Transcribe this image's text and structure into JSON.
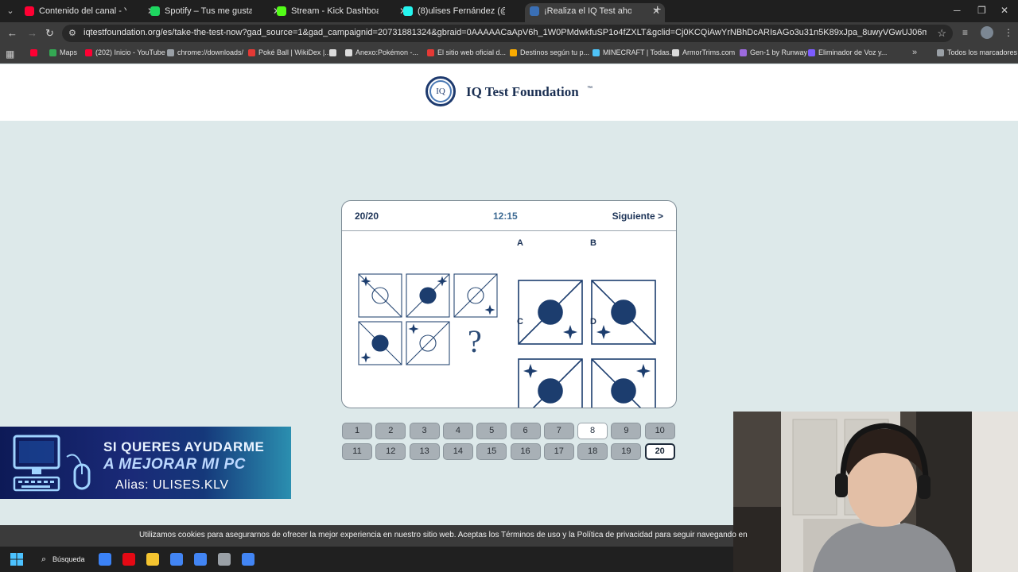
{
  "browser": {
    "tabs": [
      {
        "title": "Contenido del canal - YouTube",
        "color": "#ff0033",
        "active": false
      },
      {
        "title": "Spotify – Tus me gusta",
        "color": "#1ed760",
        "active": false
      },
      {
        "title": "Stream - Kick Dashboard",
        "color": "#53fc18",
        "active": false
      },
      {
        "title": "(8)ulises Fernández (@ulises.klv",
        "color": "#25f4ee",
        "active": false
      },
      {
        "title": "¡Realiza el IQ Test ahora!",
        "color": "#3a6fb5",
        "active": true
      }
    ],
    "tab_favicon_text": [
      "▶",
      "●",
      "K",
      "♪",
      "IQ"
    ],
    "url": "iqtestfoundation.org/es/take-the-test-now?gad_source=1&gad_campaignid=20731881324&gbraid=0AAAAACaApV6h_1W0PMdwkfuSP1o4fZXLT&gclid=Cj0KCQiAwYrNBhDcARIsAGo3u31n5K89xJpa_8uwyVGwUJ06mC_rGWIgqpREziPtqEFW03QtEx9KeY8aG-...",
    "bookmarks": [
      {
        "label": "",
        "color": "#ff0033"
      },
      {
        "label": "Maps",
        "color": "#34a853"
      },
      {
        "label": "(202) Inicio - YouTube",
        "color": "#ff0033"
      },
      {
        "label": "chrome://downloads/",
        "color": "#9aa0a6"
      },
      {
        "label": "Poké Ball | WikiDex |...",
        "color": "#e53935"
      },
      {
        "label": "",
        "color": "#dcdcdc"
      },
      {
        "label": "Anexo:Pokémon -...",
        "color": "#dcdcdc"
      },
      {
        "label": "El sitio web oficial d...",
        "color": "#e53935"
      },
      {
        "label": "Destinos según tu p...",
        "color": "#f9ab00"
      },
      {
        "label": "MINECRAFT | Todas...",
        "color": "#4fc3f7"
      },
      {
        "label": "ArmorTrims.com",
        "color": "#dcdcdc"
      },
      {
        "label": "Gen-1 by Runway",
        "color": "#9c6ade"
      },
      {
        "label": "Eliminador de Voz y...",
        "color": "#7c5cff"
      },
      {
        "label": "Todos los marcadores",
        "color": "#9aa0a6"
      }
    ]
  },
  "site": {
    "logo_mark": "IQ",
    "logo_text": "IQ Test Foundation",
    "logo_tm": "™"
  },
  "test": {
    "progress": "20/20",
    "timer": "12:15",
    "next_label": "Siguiente >",
    "question_mark": "?",
    "answer_labels": [
      "A",
      "B",
      "C",
      "D"
    ],
    "colors": {
      "ink": "#1c3d6e",
      "stroke": "#2a4a75"
    }
  },
  "question_nav": {
    "numbers": [
      "1",
      "2",
      "3",
      "4",
      "5",
      "6",
      "7",
      "8",
      "9",
      "10",
      "11",
      "12",
      "13",
      "14",
      "15",
      "16",
      "17",
      "18",
      "19",
      "20"
    ],
    "white_items": [
      "8"
    ],
    "current": "20"
  },
  "banner": {
    "line1": "SI QUERES AYUDARME",
    "line2": "A MEJORAR MI PC",
    "line3": "Alias: ULISES.KLV"
  },
  "cookie_notice": "Utilizamos cookies para asegurarnos de ofrecer la mejor experiencia en nuestro sitio web. Aceptas los Términos de uso y la Política de privacidad para seguir navegando en",
  "taskbar": {
    "search_label": "Búsqueda",
    "apps": [
      "#3b82f6",
      "#e50914",
      "#f4c430",
      "#4285f4",
      "#4285f4",
      "#9aa0a6",
      "#4285f4"
    ]
  }
}
